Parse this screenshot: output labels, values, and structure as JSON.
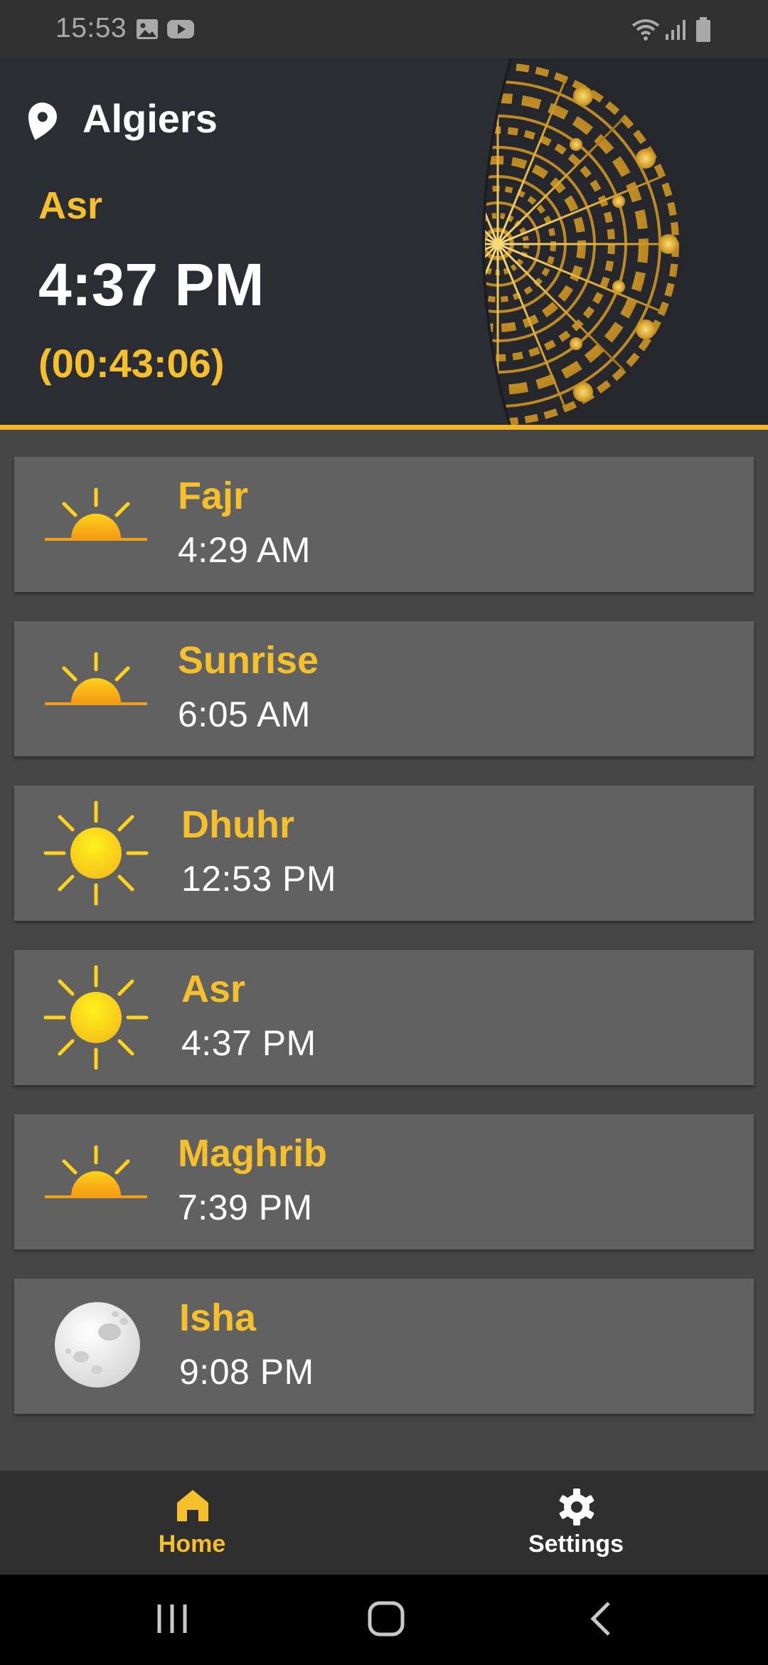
{
  "status_bar": {
    "time": "15:53",
    "icons": [
      "image-icon",
      "youtube-icon",
      "wifi-icon",
      "signal-icon",
      "battery-icon"
    ]
  },
  "header": {
    "city": "Algiers",
    "current_prayer": "Asr",
    "current_time": "4:37 PM",
    "countdown": "(00:43:06)",
    "location_icon": "location-pin-icon",
    "ornament": "mandala-decoration"
  },
  "prayers": [
    {
      "name": "Fajr",
      "time": "4:29 AM",
      "icon": "sunrise-icon"
    },
    {
      "name": "Sunrise",
      "time": "6:05 AM",
      "icon": "sunrise-icon"
    },
    {
      "name": "Dhuhr",
      "time": "12:53 PM",
      "icon": "sun-icon"
    },
    {
      "name": "Asr",
      "time": "4:37 PM",
      "icon": "sun-icon"
    },
    {
      "name": "Maghrib",
      "time": "7:39 PM",
      "icon": "sunset-icon"
    },
    {
      "name": "Isha",
      "time": "9:08 PM",
      "icon": "moon-icon"
    }
  ],
  "bottom_nav": {
    "home_label": "Home",
    "settings_label": "Settings",
    "active": "Home"
  },
  "colors": {
    "accent": "#f6c02d",
    "header_bg": "#2b2d35",
    "card_bg": "#616161",
    "page_bg": "#454545"
  }
}
